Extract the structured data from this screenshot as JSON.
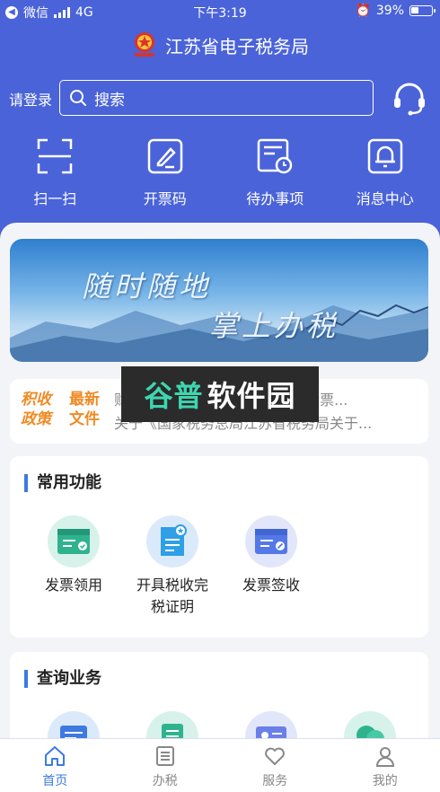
{
  "status_bar": {
    "back_app": "微信",
    "network": "4G",
    "time": "下午3:19",
    "battery": "39%",
    "battery_level": 0.39
  },
  "header": {
    "title": "江苏省电子税务局"
  },
  "search": {
    "login_label": "请登录",
    "placeholder": "搜索"
  },
  "quick_actions": [
    {
      "label": "扫一扫",
      "icon": "scan-icon"
    },
    {
      "label": "开票码",
      "icon": "invoice-code-icon"
    },
    {
      "label": "待办事项",
      "icon": "todo-icon"
    },
    {
      "label": "消息中心",
      "icon": "bell-icon"
    }
  ],
  "banner": {
    "line1": "随时随地",
    "line2": "掌上办税"
  },
  "policy": {
    "badge1": "积收政策",
    "badge2": "最新文件",
    "item1": "财政部 税务总局关于个人转让股票...",
    "item2": "关于《国家税务总局江苏省税务局关于..."
  },
  "watermark": {
    "part1": "谷普",
    "part2": "软件园"
  },
  "common_functions": {
    "title": "常用功能",
    "items": [
      {
        "label": "发票领用",
        "icon": "invoice-receive-icon"
      },
      {
        "label": "开具税收完税证明",
        "icon": "tax-certificate-icon"
      },
      {
        "label": "发票签收",
        "icon": "invoice-sign-icon"
      }
    ]
  },
  "query_business": {
    "title": "查询业务"
  },
  "tabs": [
    {
      "label": "首页",
      "icon": "home-icon",
      "active": true
    },
    {
      "label": "办税",
      "icon": "list-icon",
      "active": false
    },
    {
      "label": "服务",
      "icon": "heart-icon",
      "active": false
    },
    {
      "label": "我的",
      "icon": "user-icon",
      "active": false
    }
  ],
  "colors": {
    "brand_blue": "#4a63d9",
    "accent_blue": "#3d7ae0",
    "policy_orange": "#f08a24"
  }
}
